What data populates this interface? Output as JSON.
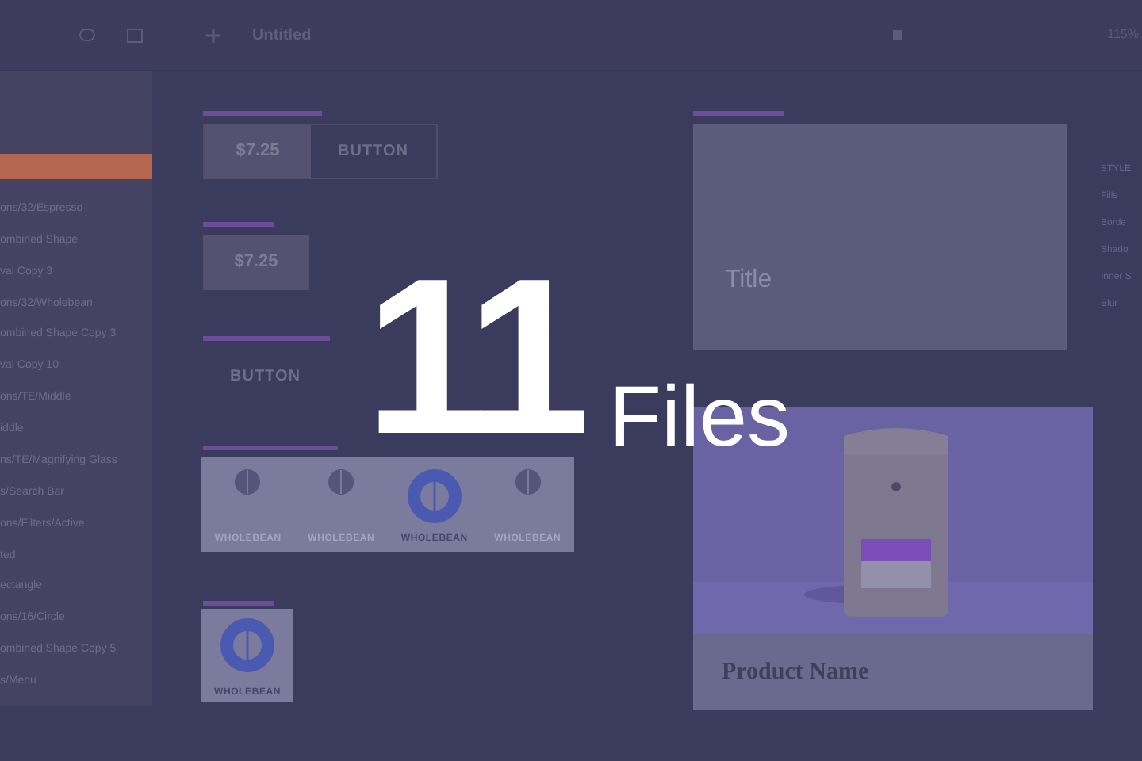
{
  "toolbar": {
    "title": "Untitled",
    "zoom": "115%"
  },
  "layers": [
    {
      "selected": true
    },
    {
      "name": "ons/32/Espresso",
      "selected": false
    },
    {
      "name": "ombined Shape",
      "selected": false
    },
    {
      "name": "val Copy 3",
      "selected": false
    },
    {
      "name": "ons/32/Wholebean",
      "selected": false
    },
    {
      "name": "ombined Shape Copy 3",
      "selected": false
    },
    {
      "name": "val Copy 10",
      "selected": false
    },
    {
      "name": "ons/TE/Middle",
      "selected": false
    },
    {
      "name": "iddle",
      "selected": false
    },
    {
      "name": "ns/TE/Magnifying Glass",
      "selected": false
    },
    {
      "name": "s/Search Bar",
      "selected": false
    },
    {
      "name": "ons/Filters/Active",
      "selected": false
    },
    {
      "name": "ted",
      "selected": false
    },
    {
      "name": "ectangle",
      "selected": false
    },
    {
      "name": "ons/16/Circle",
      "selected": false
    },
    {
      "name": "ombined Shape Copy 5",
      "selected": false
    },
    {
      "name": "s/Menu",
      "selected": false
    }
  ],
  "canvas": {
    "price_button": {
      "price": "$7.25",
      "label": "BUTTON"
    },
    "price_only": "$7.25",
    "button_only": "BUTTON",
    "bean_tabs": [
      {
        "label": "WHOLEBEAN",
        "selected": false
      },
      {
        "label": "WHOLEBEAN",
        "selected": false
      },
      {
        "label": "WHOLEBEAN",
        "selected": true
      },
      {
        "label": "WHOLEBEAN",
        "selected": false
      }
    ],
    "bean_card": "WHOLEBEAN",
    "text_card": "Title",
    "product_card": {
      "kind": "picture",
      "name": "Product Name"
    }
  },
  "inspector": [
    "STYLE",
    "Fills",
    "Borde",
    "Shado",
    "Inner S",
    "Blur"
  ],
  "headline": {
    "number": "11",
    "word": "Files"
  }
}
